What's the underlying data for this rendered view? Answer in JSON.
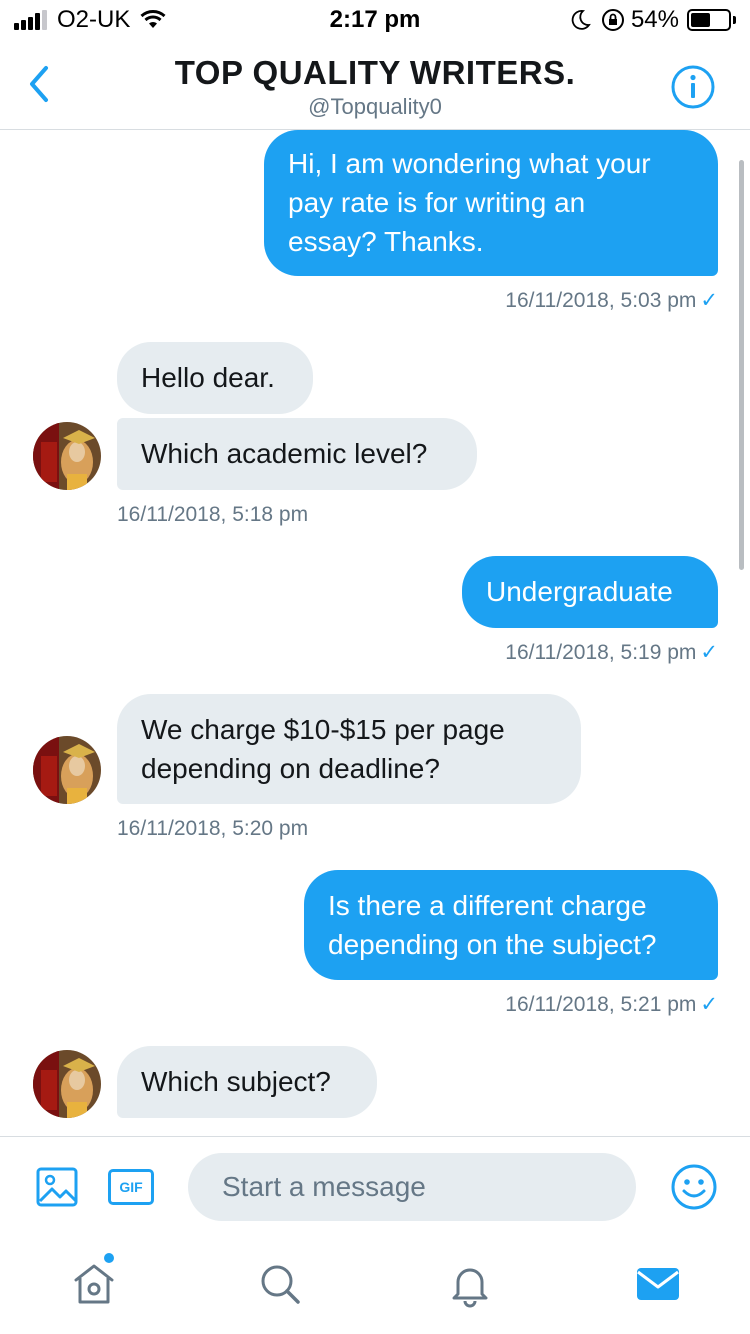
{
  "status_bar": {
    "carrier": "O2-UK",
    "time": "2:17 pm",
    "battery_percent": "54%",
    "battery_level": 0.54
  },
  "header": {
    "title": "TOP QUALITY WRITERS.",
    "handle": "@Topquality0"
  },
  "messages": [
    {
      "side": "out",
      "lines": [
        "Hi, I am wondering what your",
        "pay rate is for writing an",
        "essay? Thanks."
      ]
    },
    {
      "side": "out-ts",
      "timestamp": "16/11/2018, 5:03 pm",
      "check": "✓"
    },
    {
      "side": "in",
      "lines": [
        "Hello dear."
      ]
    },
    {
      "side": "in",
      "lines": [
        "Which academic level?"
      ]
    },
    {
      "side": "in-ts",
      "timestamp": "16/11/2018, 5:18 pm"
    },
    {
      "side": "out",
      "lines": [
        "Undergraduate"
      ]
    },
    {
      "side": "out-ts",
      "timestamp": "16/11/2018, 5:19 pm",
      "check": "✓"
    },
    {
      "side": "in",
      "lines": [
        "We charge $10-$15 per page",
        "depending on deadline?"
      ]
    },
    {
      "side": "in-ts",
      "timestamp": "16/11/2018, 5:20 pm"
    },
    {
      "side": "out",
      "lines": [
        "Is there a different charge",
        "depending on the subject?"
      ]
    },
    {
      "side": "out-ts",
      "timestamp": "16/11/2018, 5:21 pm",
      "check": "✓"
    },
    {
      "side": "in",
      "lines": [
        "Which subject?"
      ]
    }
  ],
  "composer": {
    "gif_label": "GIF",
    "placeholder": "Start a message"
  },
  "icons": {
    "back": "chevron-left-icon",
    "info": "info-icon",
    "media": "image-icon",
    "emoji": "smiley-icon",
    "tabs": [
      "home-icon",
      "search-icon",
      "bell-icon",
      "mail-icon"
    ]
  },
  "colors": {
    "accent": "#1da1f2",
    "incoming_bubble": "#e6ecf0",
    "muted_text": "#657786"
  }
}
